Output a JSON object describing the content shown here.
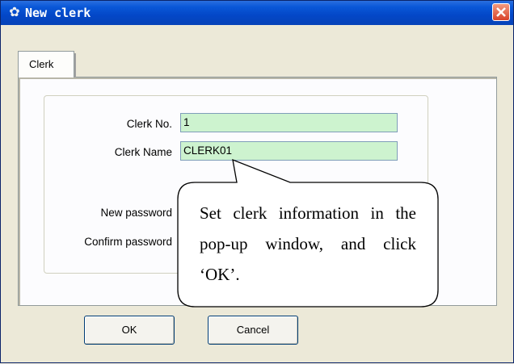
{
  "window": {
    "title": "New clerk"
  },
  "tabs": [
    {
      "label": "Clerk"
    }
  ],
  "form": {
    "clerk_no_label": "Clerk No.",
    "clerk_no_value": "1",
    "clerk_name_label": "Clerk Name",
    "clerk_name_value": "CLERK01",
    "new_password_label": "New password",
    "confirm_password_label": "Confirm password"
  },
  "buttons": {
    "ok_label": "OK",
    "cancel_label": "Cancel"
  },
  "callout": {
    "text": "Set clerk information in the pop-up window, and click ‘OK’."
  },
  "colors": {
    "titlebar": "#0a58d8",
    "field_bg": "#cdf3cf",
    "close": "#d8422a"
  }
}
